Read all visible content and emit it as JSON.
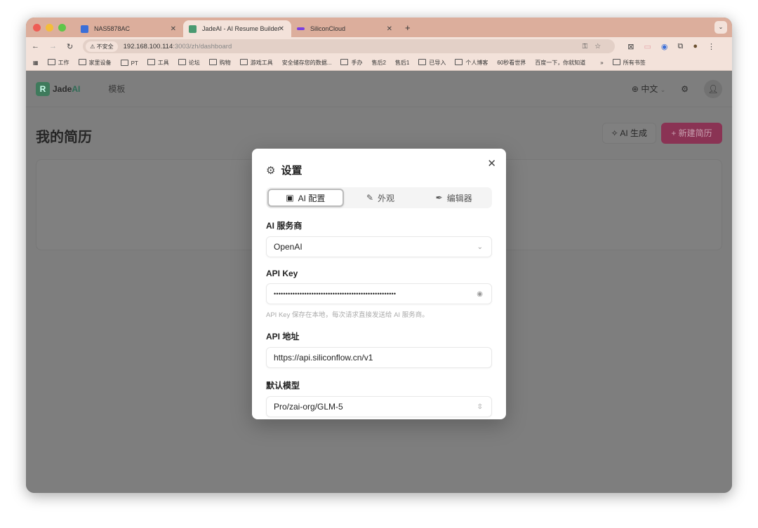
{
  "browser": {
    "tabs": [
      {
        "label": "NAS5878AC",
        "icon_color": "#3b6fd8"
      },
      {
        "label": "JadeAI - AI Resume Builder",
        "icon_color": "#4a9a72",
        "active": true
      },
      {
        "label": "SiliconCloud",
        "icon_color": "#7b3fe0"
      }
    ],
    "security_label": "不安全",
    "url_host": "192.168.100.114",
    "url_path": ":3003/zh/dashboard",
    "bookmarks": [
      "工作",
      "家里设备",
      "PT",
      "工具",
      "论坛",
      "购物",
      "游戏工具",
      "安全储存您的数据...",
      "手办",
      "售后2",
      "售后1",
      "已导入",
      "个人博客",
      "60秒看世界",
      "百度一下，你就知道"
    ],
    "bookmarks_overflow": "»",
    "all_bookmarks": "所有书签"
  },
  "app": {
    "brand_prefix": "Jade",
    "brand_suffix": "AI",
    "logo_letter": "R",
    "nav_templates": "模板",
    "language": "中文",
    "page_title": "我的简历",
    "ai_generate": "AI 生成",
    "new_resume": "新建简历",
    "accent_color": "#8a3354"
  },
  "modal": {
    "title": "设置",
    "tabs": [
      {
        "label": "AI 配置",
        "active": true
      },
      {
        "label": "外观"
      },
      {
        "label": "编辑器"
      }
    ],
    "provider_label": "AI 服务商",
    "provider_value": "OpenAI",
    "api_key_label": "API Key",
    "api_key_value": "••••••••••••••••••••••••••••••••••••••••••••••••••••",
    "api_key_hint": "API Key 保存在本地，每次请求直接发送给 AI 服务商。",
    "api_url_label": "API 地址",
    "api_url_value": "https://api.siliconflow.cn/v1",
    "model_label": "默认模型",
    "model_value": "Pro/zai-org/GLM-5"
  }
}
